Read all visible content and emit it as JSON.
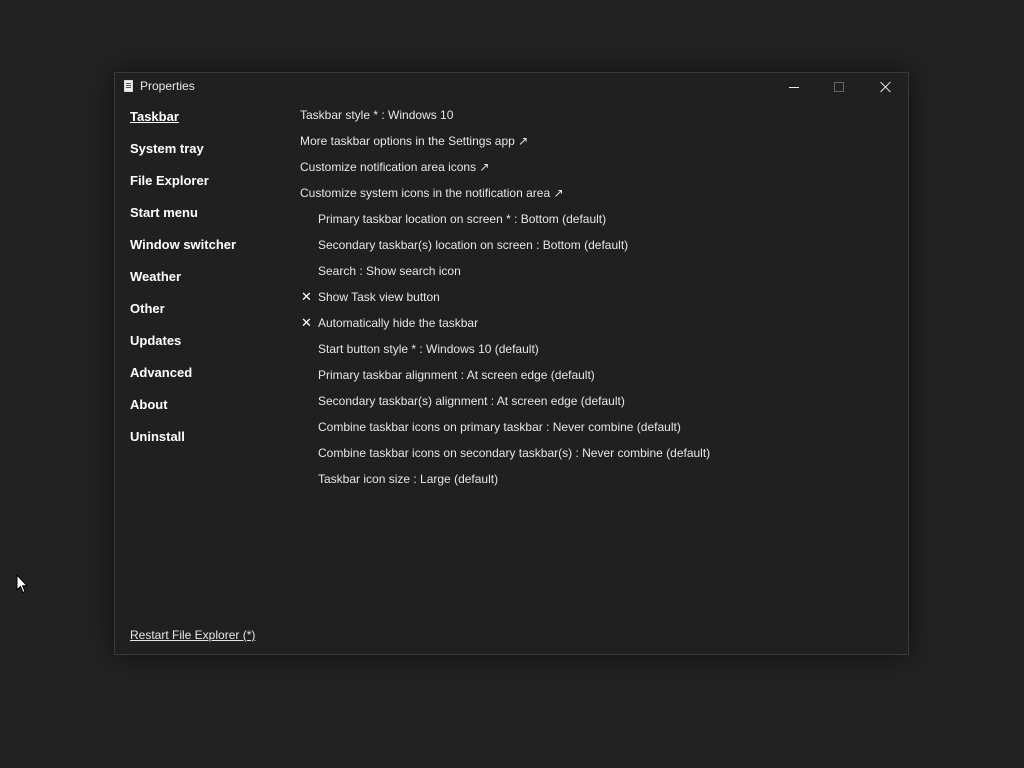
{
  "window": {
    "title": "Properties",
    "app_icon": "properties-page-icon",
    "controls": {
      "minimize": "minimize-icon",
      "maximize": "maximize-icon",
      "close": "close-icon"
    }
  },
  "sidebar": {
    "items": [
      {
        "label": "Taskbar",
        "active": true
      },
      {
        "label": "System tray"
      },
      {
        "label": "File Explorer"
      },
      {
        "label": "Start menu"
      },
      {
        "label": "Window switcher"
      },
      {
        "label": "Weather"
      },
      {
        "label": "Other"
      },
      {
        "label": "Updates"
      },
      {
        "label": "Advanced"
      },
      {
        "label": "About"
      },
      {
        "label": "Uninstall"
      }
    ]
  },
  "settings": [
    {
      "text": "Taskbar style * : Windows 10",
      "indent": false
    },
    {
      "text": "More taskbar options in the Settings app ↗",
      "indent": false
    },
    {
      "text": "Customize notification area icons ↗",
      "indent": false
    },
    {
      "text": "Customize system icons in the notification area ↗",
      "indent": false
    },
    {
      "text": "Primary taskbar location on screen * : Bottom (default)",
      "indent": true
    },
    {
      "text": "Secondary taskbar(s) location on screen : Bottom (default)",
      "indent": true
    },
    {
      "text": "Search : Show search icon",
      "indent": true
    },
    {
      "text": "Show Task view button",
      "indent": true,
      "checked": true
    },
    {
      "text": "Automatically hide the taskbar",
      "indent": true,
      "checked": true
    },
    {
      "text": "Start button style * : Windows 10 (default)",
      "indent": true
    },
    {
      "text": "Primary taskbar alignment : At screen edge (default)",
      "indent": true
    },
    {
      "text": "Secondary taskbar(s) alignment : At screen edge (default)",
      "indent": true
    },
    {
      "text": "Combine taskbar icons on primary taskbar : Never combine (default)",
      "indent": true
    },
    {
      "text": "Combine taskbar icons on secondary taskbar(s) : Never combine (default)",
      "indent": true
    },
    {
      "text": "Taskbar icon size : Large (default)",
      "indent": true
    }
  ],
  "check_glyph": "✕",
  "footer": {
    "restart_link": "Restart File Explorer (*)"
  },
  "colors": {
    "desktop": "#222222",
    "window_bg": "#202020",
    "text": "#e6e6e6"
  }
}
